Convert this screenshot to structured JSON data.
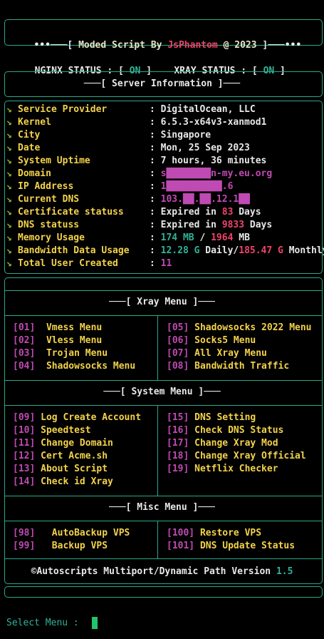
{
  "header": {
    "deco_left": "•••───[ ",
    "title_prefix": "Moded Script By ",
    "author": "JsPhantom",
    "year_text": " @ 2023 ",
    "deco_right": "]───•••"
  },
  "status": {
    "nginx_label": "NGINX STATUS : [ ",
    "nginx_value": "ON",
    "close1": " ]",
    "xray_label": "XRAY STATUS : [ ",
    "xray_value": "ON",
    "close2": " ]"
  },
  "server_info": {
    "title": "───[ Server Information ]───",
    "rows": [
      {
        "label": "Service Provider",
        "value": "DigitalOcean, LLC"
      },
      {
        "label": "Kernel",
        "value": "6.5.3-x64v3-xanmod1"
      },
      {
        "label": "City",
        "value": "Singapore"
      },
      {
        "label": "Date",
        "value": "Mon, 25 Sep 2023"
      },
      {
        "label": "System Uptime",
        "value": "7 hours, 36 minutes"
      },
      {
        "label": "Domain",
        "value": "s████████n-my.eu.org"
      },
      {
        "label": "IP Address",
        "value": "1██████████.6"
      },
      {
        "label": "Current DNS",
        "value": "103.██.██.12.1██"
      },
      {
        "label": "Certificate statuss",
        "value": "Expired in ",
        "num": "83",
        "suffix": " Days"
      },
      {
        "label": "DNS statuss",
        "value": "Expired in ",
        "num": "9833",
        "suffix": " Days"
      },
      {
        "label": "Memory Usage",
        "used": "174 MB",
        "sep": " / ",
        "total": "1964",
        "unit": " MB"
      },
      {
        "label": "Bandwidth Data Usage",
        "daily": "12.28 G",
        "daily_label": " Daily/",
        "monthly": "185.47 G",
        "monthly_label": " Monthly"
      },
      {
        "label": "Total User Created",
        "value": "11"
      }
    ]
  },
  "xray_menu": {
    "title": "───[ Xray Menu ]───",
    "left": [
      {
        "num": "[01]",
        "label": "Vmess Menu"
      },
      {
        "num": "[02]",
        "label": "Vless Menu"
      },
      {
        "num": "[03]",
        "label": "Trojan Menu"
      },
      {
        "num": "[04]",
        "label": "Shadowsocks Menu"
      }
    ],
    "right": [
      {
        "num": "[05]",
        "label": "Shadowsocks 2022 Menu"
      },
      {
        "num": "[06]",
        "label": "Socks5 Menu"
      },
      {
        "num": "[07]",
        "label": "All Xray Menu"
      },
      {
        "num": "[08]",
        "label": "Bandwidth Traffic"
      }
    ]
  },
  "system_menu": {
    "title": "───[ System Menu ]───",
    "left": [
      {
        "num": "[09]",
        "label": "Log Create Account"
      },
      {
        "num": "[10]",
        "label": "Speedtest"
      },
      {
        "num": "[11]",
        "label": "Change Domain"
      },
      {
        "num": "[12]",
        "label": "Cert Acme.sh"
      },
      {
        "num": "[13]",
        "label": "About Script"
      },
      {
        "num": "[14]",
        "label": "Check id Xray"
      }
    ],
    "right": [
      {
        "num": "[15]",
        "label": "DNS Setting"
      },
      {
        "num": "[16]",
        "label": "Check DNS Status"
      },
      {
        "num": "[17]",
        "label": "Change Xray Mod"
      },
      {
        "num": "[18]",
        "label": "Change Xray Official"
      },
      {
        "num": "[19]",
        "label": "Netflix Checker"
      }
    ]
  },
  "misc_menu": {
    "title": "───[ Misc Menu ]───",
    "left": [
      {
        "num": "[98]",
        "label": "AutoBackup VPS"
      },
      {
        "num": "[99]",
        "label": "Backup VPS"
      }
    ],
    "right": [
      {
        "num": "[100]",
        "label": "Restore VPS"
      },
      {
        "num": "[101]",
        "label": "DNS Update Status"
      }
    ]
  },
  "footer": {
    "text": "©Autoscripts Multiport/Dynamic Path Version ",
    "version": "1.5"
  },
  "prompt": {
    "text": "Select Menu : "
  },
  "colors": {
    "border": "#2aa889",
    "label": "#f2d24a",
    "number": "#c04ab3",
    "status_on": "#2fb39a",
    "accent": "#f0436a"
  }
}
